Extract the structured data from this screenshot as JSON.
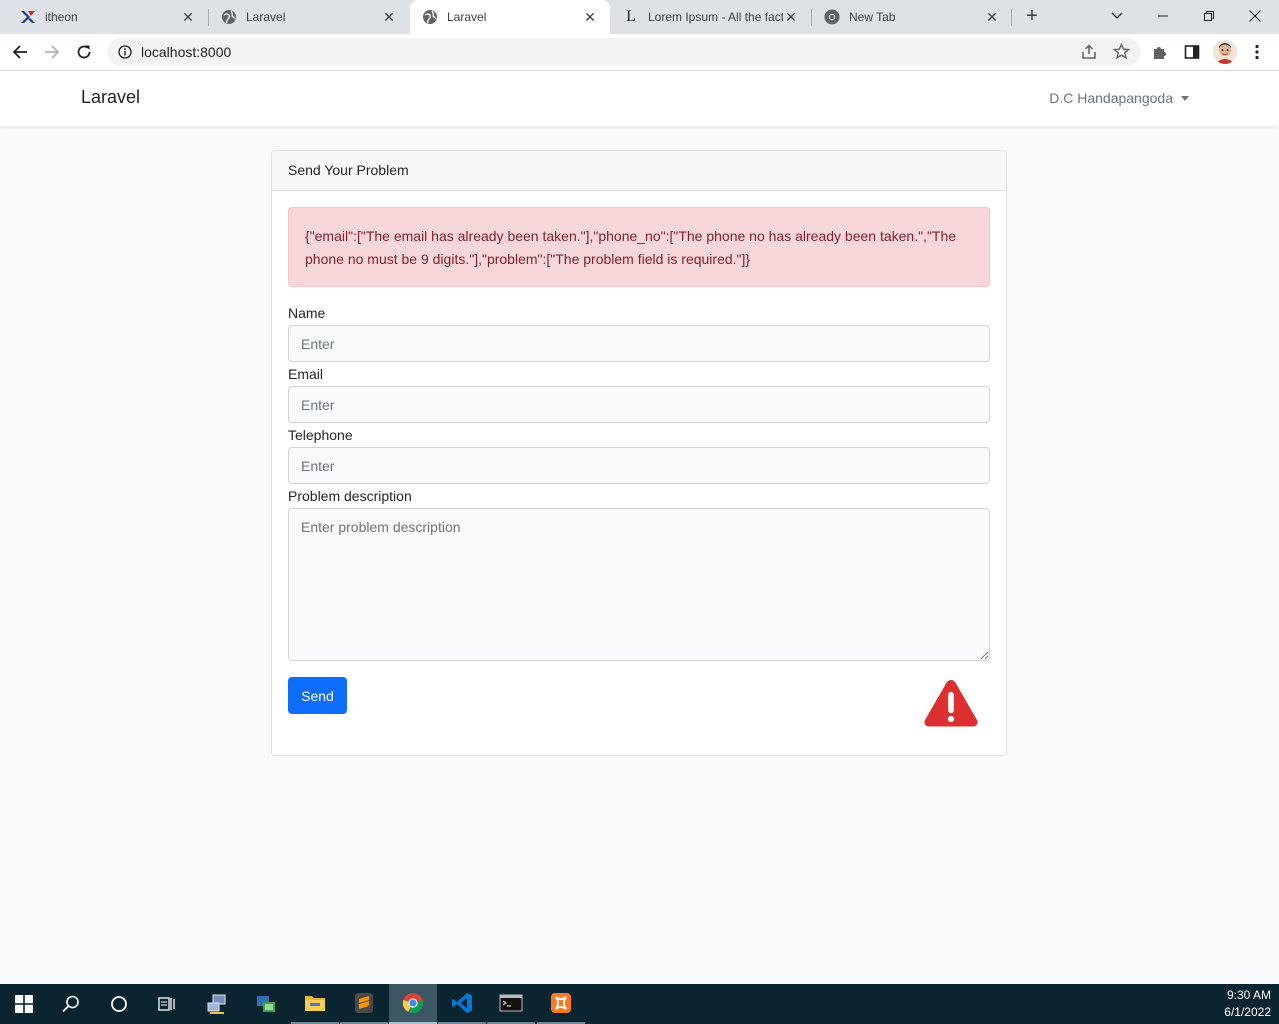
{
  "browser": {
    "tabs": [
      {
        "title": "itheon",
        "icon": "itheon-logo-icon",
        "active": false
      },
      {
        "title": "Laravel",
        "icon": "globe-icon",
        "active": false
      },
      {
        "title": "Laravel",
        "icon": "globe-icon",
        "active": true
      },
      {
        "title": "Lorem Ipsum - All the facts",
        "icon": "lipsum-logo-icon",
        "active": false
      },
      {
        "title": "New Tab",
        "icon": "chrome-icon",
        "active": false
      }
    ],
    "url": "localhost:8000"
  },
  "navbar": {
    "brand": "Laravel",
    "user_name": "D.C Handapangoda"
  },
  "card": {
    "header": "Send Your Problem",
    "error_text": "{\"email\":[\"The email has already been taken.\"],\"phone_no\":[\"The phone no has already been taken.\",\"The phone no must be 9 digits.\"],\"problem\":[\"The problem field is required.\"]}",
    "fields": {
      "name": {
        "label": "Name",
        "placeholder": "Enter",
        "value": ""
      },
      "email": {
        "label": "Email",
        "placeholder": "Enter",
        "value": ""
      },
      "telephone": {
        "label": "Telephone",
        "placeholder": "Enter",
        "value": ""
      },
      "problem": {
        "label": "Problem description",
        "placeholder": "Enter problem description",
        "value": ""
      }
    },
    "send_label": "Send",
    "warning_icon": "warning-triangle-icon",
    "warning_color": "#dc2f2f"
  },
  "taskbar": {
    "apps": [
      "start-icon",
      "search-icon",
      "cortana-icon",
      "task-view-icon",
      "network-icon",
      "remote-desktop-icon",
      "file-explorer-icon",
      "sublime-text-icon",
      "chrome-icon",
      "vscode-icon",
      "terminal-icon",
      "xampp-icon"
    ],
    "time": "9:30 AM",
    "date": "6/1/2022"
  },
  "colors": {
    "primary": "#0d6efd",
    "alert_bg": "#f8d7da",
    "alert_text": "#842029",
    "taskbar": "#0b2530"
  }
}
